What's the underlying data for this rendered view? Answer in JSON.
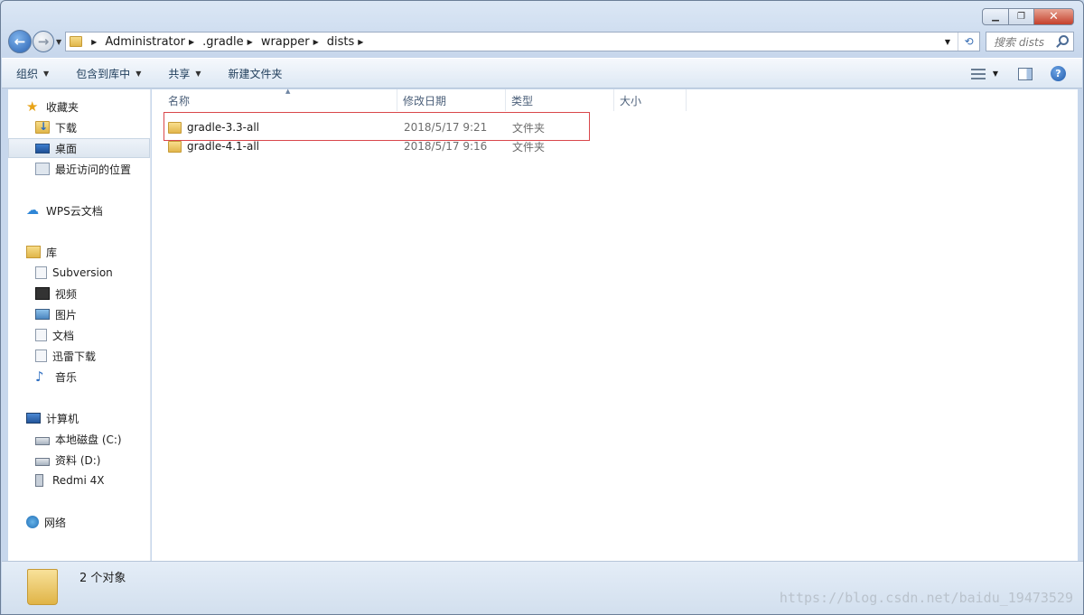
{
  "window": {
    "caption": {
      "minimize": "▁",
      "maximize": "❐",
      "close": "✕"
    }
  },
  "address": {
    "crumbs": [
      "Administrator",
      ".gradle",
      "wrapper",
      "dists"
    ],
    "search_placeholder": "搜索 dists"
  },
  "toolbar": {
    "items": [
      "组织",
      "包含到库中",
      "共享",
      "新建文件夹"
    ]
  },
  "nav": {
    "favorites": {
      "label": "收藏夹",
      "items": [
        "下载",
        "桌面",
        "最近访问的位置"
      ]
    },
    "wps": "WPS云文档",
    "library": {
      "label": "库",
      "items": [
        "Subversion",
        "视频",
        "图片",
        "文档",
        "迅雷下载",
        "音乐"
      ]
    },
    "computer": {
      "label": "计算机",
      "items": [
        "本地磁盘 (C:)",
        "资料 (D:)",
        "Redmi 4X"
      ]
    },
    "network": "网络"
  },
  "columns": {
    "name": "名称",
    "date": "修改日期",
    "type": "类型",
    "size": "大小"
  },
  "files": [
    {
      "name": "gradle-3.3-all",
      "date": "2018/5/17 9:21",
      "type": "文件夹"
    },
    {
      "name": "gradle-4.1-all",
      "date": "2018/5/17 9:16",
      "type": "文件夹"
    }
  ],
  "status": {
    "count": "2 个对象"
  },
  "watermark": "https://blog.csdn.net/baidu_19473529"
}
